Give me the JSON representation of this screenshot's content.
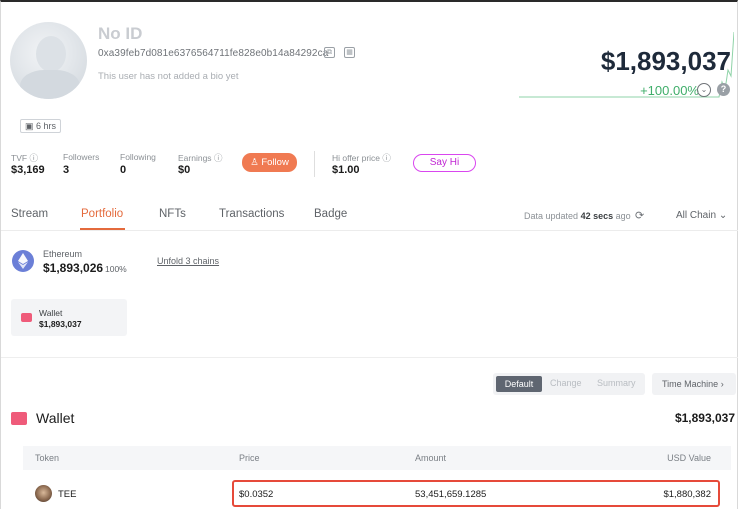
{
  "profile": {
    "name": "No ID",
    "address": "0xa39feb7d081e6376564711fe828e0b14a84292ca",
    "bio": "This user has not added a bio yet",
    "active_time": "6 hrs"
  },
  "balance": {
    "total": "$1,893,037",
    "change_pct": "+100.00%"
  },
  "stats": {
    "tvf_label": "TVF",
    "tvf_value": "$3,169",
    "followers_label": "Followers",
    "followers_value": "3",
    "following_label": "Following",
    "following_value": "0",
    "earnings_label": "Earnings",
    "earnings_value": "$0",
    "follow_button": "Follow",
    "offer_label": "Hi offer price",
    "offer_value": "$1.00",
    "sayhi_button": "Say Hi"
  },
  "tabs": [
    {
      "label": "Stream"
    },
    {
      "label": "Portfolio"
    },
    {
      "label": "NFTs"
    },
    {
      "label": "Transactions"
    },
    {
      "label": "Badge"
    }
  ],
  "update": {
    "prefix": "Data updated",
    "time": "42 secs",
    "suffix": "ago",
    "chain_select": "All Chain"
  },
  "chain": {
    "name": "Ethereum",
    "value": "$1,893,026",
    "pct": "100%",
    "unfold": "Unfold 3 chains"
  },
  "wallet_card": {
    "label": "Wallet",
    "value": "$1,893,037"
  },
  "view_toggles": {
    "default": "Default",
    "change": "Change",
    "summary": "Summary",
    "time_machine": "Time Machine"
  },
  "wallet": {
    "title": "Wallet",
    "total": "$1,893,037",
    "columns": [
      "Token",
      "Price",
      "Amount",
      "USD Value"
    ],
    "rows": [
      {
        "token": "TEE",
        "price": "$0.0352",
        "amount": "53,451,659.1285",
        "usd_value": "$1,880,382"
      }
    ]
  },
  "colors": {
    "accent": "#e46a3c",
    "positive": "#3fae6a",
    "highlight": "#e64a3a",
    "wallet": "#ef5b7a"
  }
}
